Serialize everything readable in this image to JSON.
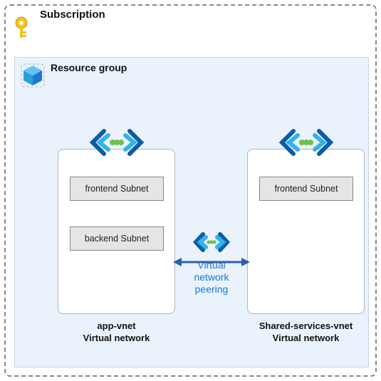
{
  "subscription": {
    "title": "Subscription"
  },
  "resource_group": {
    "title": "Resource group"
  },
  "vnets": {
    "left": {
      "name": "app-vnet",
      "type_label": "Virtual network",
      "subnet1": "frontend Subnet",
      "subnet2": "backend Subnet"
    },
    "right": {
      "name": "Shared-services-vnet",
      "type_label": "Virtual network",
      "subnet1": "frontend Subnet"
    }
  },
  "peering": {
    "line1": "Virtual network",
    "line2": "peering"
  },
  "colors": {
    "bg_rg": "#eaf2fb",
    "accent": "#1a78d6",
    "arrow": "#2a5fb0",
    "subnet_fill": "#e5e5e5",
    "key": "#f2c31e",
    "green": "#6cc24a",
    "brack_outer": "#0b5cab",
    "brack_inner": "#33b4e6"
  }
}
